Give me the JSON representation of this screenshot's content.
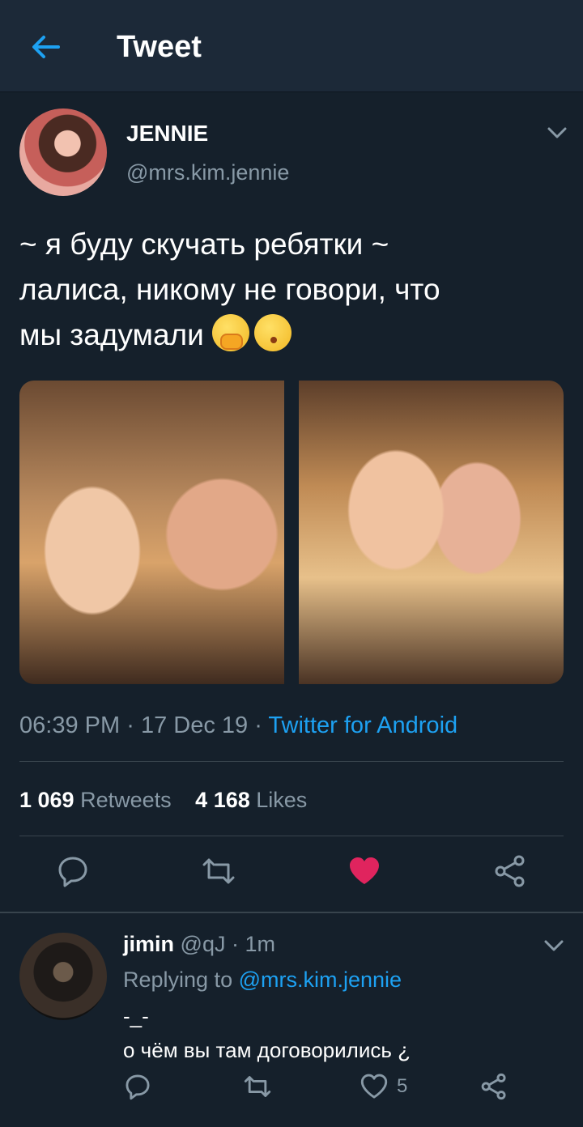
{
  "header": {
    "title": "Tweet",
    "back_icon": "arrow-left-icon"
  },
  "tweet": {
    "display_name": "JENNIE",
    "handle": "@mrs.kim.jennie",
    "text": "~ я буду скучать ребятки ~\nлалиса, никому не говори, что\nмы задумали",
    "emojis": [
      "hand-over-mouth-emoji",
      "kissing-face-emoji"
    ],
    "time": "06:39 PM",
    "date": "17 Dec 19",
    "separator": "·",
    "source": "Twitter for Android",
    "retweets_count": "1 069",
    "retweets_label": "Retweets",
    "likes_count": "4 168",
    "likes_label": "Likes",
    "liked": true
  },
  "reply": {
    "name": "jimin",
    "handle": "@qJ",
    "age": "1m",
    "replying_prefix": "Replying to",
    "replying_to": "@mrs.kim.jennie",
    "text": "-_-\nо чём вы там договорились ¿",
    "likes_count": "5"
  },
  "colors": {
    "background": "#15202b",
    "header": "#1c2938",
    "accent": "#1da1f2",
    "secondary_text": "#8899a6",
    "like": "#e0245e"
  }
}
